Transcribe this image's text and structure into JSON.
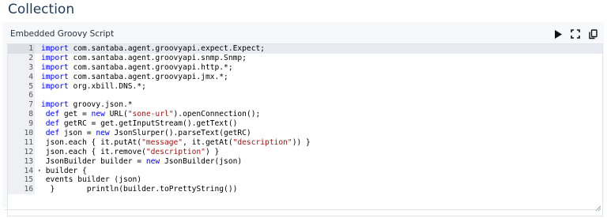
{
  "section_title": "Collection",
  "panel": {
    "title": "Embedded Groovy Script"
  },
  "toolbar": {
    "run_icon": "play-icon",
    "expand_icon": "fullscreen-icon",
    "copy_icon": "copy-icon"
  },
  "editor": {
    "active_line": 1,
    "lines": [
      {
        "n": "1",
        "parts": [
          [
            "kw",
            "import"
          ],
          [
            "",
            "com.santaba.agent.groovyapi.expect.Expect;"
          ]
        ]
      },
      {
        "n": "2",
        "parts": [
          [
            "kw",
            "import"
          ],
          [
            "",
            "com.santaba.agent.groovyapi.snmp.Snmp;"
          ]
        ]
      },
      {
        "n": "3",
        "parts": [
          [
            "kw",
            "import"
          ],
          [
            "",
            "com.santaba.agent.groovyapi.http.*;"
          ]
        ]
      },
      {
        "n": "4",
        "parts": [
          [
            "kw",
            "import"
          ],
          [
            "",
            "com.santaba.agent.groovyapi.jmx.*;"
          ]
        ]
      },
      {
        "n": "5",
        "parts": [
          [
            "kw",
            "import"
          ],
          [
            "",
            "org.xbill.DNS.*;"
          ]
        ]
      },
      {
        "n": "6",
        "parts": []
      },
      {
        "n": "7",
        "parts": [
          [
            "kw",
            "import"
          ],
          [
            "",
            "groovy.json.*"
          ]
        ]
      },
      {
        "n": "8",
        "parts": [
          [
            "kw",
            " def"
          ],
          [
            "",
            " get = "
          ],
          [
            "kw",
            "new"
          ],
          [
            "",
            " URL("
          ],
          [
            "str",
            "\"sone-url\""
          ],
          [
            "",
            ").openConnection();"
          ]
        ]
      },
      {
        "n": "9",
        "parts": [
          [
            "kw",
            " def"
          ],
          [
            "",
            " getRC = get.getInputStream().getText()"
          ]
        ]
      },
      {
        "n": "10",
        "parts": [
          [
            "kw",
            " def"
          ],
          [
            "",
            " json = "
          ],
          [
            "kw",
            "new"
          ],
          [
            "",
            " JsonSlurper().parseText(getRC)"
          ]
        ]
      },
      {
        "n": "11",
        "parts": [
          [
            "",
            " json.each { it.putAt("
          ],
          [
            "str",
            "\"message\""
          ],
          [
            "",
            ", it.getAt("
          ],
          [
            "str",
            "\"description\""
          ],
          [
            "",
            ")) }"
          ]
        ]
      },
      {
        "n": "12",
        "parts": [
          [
            "",
            " json.each { it.remove("
          ],
          [
            "str",
            "\"description\""
          ],
          [
            "",
            ") }"
          ]
        ]
      },
      {
        "n": "13",
        "parts": [
          [
            "",
            " JsonBuilder builder = "
          ],
          [
            "kw",
            "new"
          ],
          [
            "",
            " JsonBuilder(json)"
          ]
        ]
      },
      {
        "n": "14",
        "fold": "▾",
        "parts": [
          [
            "",
            " builder {"
          ]
        ]
      },
      {
        "n": "15",
        "parts": [
          [
            "",
            " events builder (json)"
          ]
        ]
      },
      {
        "n": "16",
        "parts": [
          [
            "",
            "  }       println(builder.toPrettyString())"
          ]
        ]
      }
    ]
  }
}
